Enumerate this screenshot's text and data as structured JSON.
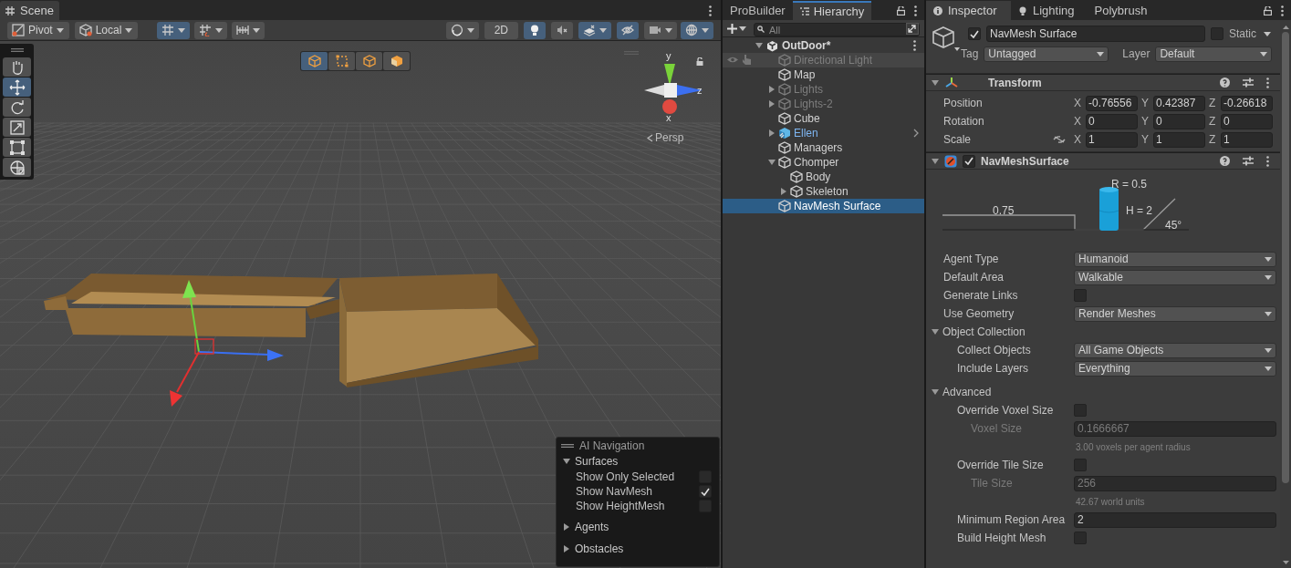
{
  "scene": {
    "tab": "Scene",
    "toolbar": [
      {
        "kind": "pivot",
        "label": "Pivot",
        "selected": false
      },
      {
        "kind": "local",
        "label": "Local",
        "selected": false
      },
      {
        "kind": "grid-snap",
        "selected": true
      },
      {
        "kind": "increment-snap",
        "selected": false
      },
      {
        "kind": "grid",
        "selected": false
      },
      {
        "kind": "shading",
        "selected": false
      },
      {
        "kind": "mode",
        "label": "2D",
        "selected": false
      },
      {
        "kind": "lighting",
        "selected": true
      },
      {
        "kind": "audio",
        "selected": false
      },
      {
        "kind": "effects",
        "selected": true
      },
      {
        "kind": "visibility",
        "selected": true
      },
      {
        "kind": "camera",
        "selected": false
      },
      {
        "kind": "gizmos",
        "selected": true
      }
    ],
    "tools": [
      {
        "kind": "hand",
        "selected": false
      },
      {
        "kind": "move",
        "selected": true
      },
      {
        "kind": "rotate",
        "selected": false
      },
      {
        "kind": "scale",
        "selected": false
      },
      {
        "kind": "rect",
        "selected": false
      },
      {
        "kind": "transform",
        "selected": false
      }
    ],
    "view_buttons": [
      {
        "kind": "cube",
        "selected": true
      },
      {
        "kind": "rect",
        "selected": false
      },
      {
        "kind": "cube",
        "selected": false
      },
      {
        "kind": "solid-cube",
        "selected": false
      }
    ],
    "orientation": {
      "y": "y",
      "z": "z",
      "x": "x",
      "projection": "Persp"
    },
    "ai_navigation": {
      "title": "AI Navigation",
      "sections": [
        {
          "label": "Surfaces",
          "expanded": true,
          "options": [
            {
              "label": "Show Only Selected",
              "checked": false
            },
            {
              "label": "Show NavMesh",
              "checked": true
            },
            {
              "label": "Show HeightMesh",
              "checked": false
            }
          ]
        },
        {
          "label": "Agents",
          "expanded": false
        },
        {
          "label": "Obstacles",
          "expanded": false
        }
      ]
    }
  },
  "hierarchy": {
    "tabs": [
      {
        "label": "ProBuilder",
        "selected": false
      },
      {
        "label": "Hierarchy",
        "selected": true
      }
    ],
    "search": {
      "placeholder": "All"
    },
    "scene_name": "OutDoor*",
    "items": [
      {
        "label": "Directional Light",
        "kind": "object",
        "disabled": true,
        "hovered": true,
        "selected": false
      },
      {
        "label": "Map",
        "kind": "object",
        "disabled": false,
        "hovered": false,
        "selected": false
      },
      {
        "label": "Lights",
        "kind": "object",
        "disabled": true,
        "hovered": false,
        "selected": false,
        "expanded": false
      },
      {
        "label": "Lights-2",
        "kind": "object",
        "disabled": true,
        "hovered": false,
        "selected": false,
        "expanded": false
      },
      {
        "label": "Cube",
        "kind": "object",
        "disabled": false,
        "hovered": false,
        "selected": false
      },
      {
        "label": "Ellen",
        "kind": "prefab",
        "disabled": false,
        "hovered": false,
        "selected": false,
        "expanded": false
      },
      {
        "label": "Managers",
        "kind": "object",
        "disabled": false,
        "hovered": false,
        "selected": false
      },
      {
        "label": "Chomper",
        "kind": "object",
        "disabled": false,
        "hovered": false,
        "selected": false,
        "expanded": true,
        "children": [
          {
            "label": "Body",
            "kind": "object",
            "disabled": false,
            "hovered": false,
            "selected": false
          },
          {
            "label": "Skeleton",
            "kind": "object",
            "disabled": false,
            "hovered": false,
            "selected": false,
            "expanded": false
          }
        ]
      },
      {
        "label": "NavMesh Surface",
        "kind": "object",
        "disabled": false,
        "hovered": false,
        "selected": true
      }
    ]
  },
  "inspector": {
    "tabs": [
      {
        "label": "Inspector",
        "selected": true
      },
      {
        "label": "Lighting",
        "selected": false
      },
      {
        "label": "Polybrush",
        "selected": false
      }
    ],
    "object": {
      "active": true,
      "name": "NavMesh Surface",
      "static": false,
      "static_label": "Static",
      "tag_label": "Tag",
      "tag": "Untagged",
      "layer_label": "Layer",
      "layer": "Default"
    },
    "transform": {
      "title": "Transform",
      "expanded": true,
      "rows": [
        {
          "label": "Position",
          "link": false,
          "values": [
            {
              "axis": "X",
              "value": "-0.76556"
            },
            {
              "axis": "Y",
              "value": "0.42387"
            },
            {
              "axis": "Z",
              "value": "-0.26618"
            }
          ]
        },
        {
          "label": "Rotation",
          "link": false,
          "values": [
            {
              "axis": "X",
              "value": "0"
            },
            {
              "axis": "Y",
              "value": "0"
            },
            {
              "axis": "Z",
              "value": "0"
            }
          ]
        },
        {
          "label": "Scale",
          "link": true,
          "values": [
            {
              "axis": "X",
              "value": "1"
            },
            {
              "axis": "Y",
              "value": "1"
            },
            {
              "axis": "Z",
              "value": "1"
            }
          ]
        }
      ]
    },
    "navmesh": {
      "title": "NavMeshSurface",
      "enabled": true,
      "expanded": true,
      "diagram": {
        "radius": "R = 0.5",
        "step": "0.75",
        "height": "H = 2",
        "slope": "45°"
      },
      "fields": [
        {
          "kind": "dropdown",
          "label": "Agent Type",
          "value": "Humanoid"
        },
        {
          "kind": "dropdown",
          "label": "Default Area",
          "value": "Walkable"
        },
        {
          "kind": "checkbox",
          "label": "Generate Links",
          "checked": false
        },
        {
          "kind": "dropdown",
          "label": "Use Geometry",
          "value": "Render Meshes"
        },
        {
          "kind": "section",
          "label": "Object Collection",
          "expanded": true,
          "children": [
            {
              "kind": "dropdown",
              "label": "Collect Objects",
              "value": "All Game Objects"
            },
            {
              "kind": "dropdown",
              "label": "Include Layers",
              "value": "Everything"
            }
          ]
        },
        {
          "kind": "section",
          "label": "Advanced",
          "expanded": true,
          "children": [
            {
              "kind": "checkbox",
              "label": "Override Voxel Size",
              "checked": false,
              "children": [
                {
                  "kind": "number",
                  "label": "Voxel Size",
                  "value": "0.1666667",
                  "disabled": true
                },
                {
                  "kind": "hint",
                  "label": "3.00 voxels per agent radius"
                }
              ]
            },
            {
              "kind": "checkbox",
              "label": "Override Tile Size",
              "checked": false,
              "children": [
                {
                  "kind": "number",
                  "label": "Tile Size",
                  "value": "256",
                  "disabled": true
                },
                {
                  "kind": "hint",
                  "label": "42.67 world units"
                }
              ]
            },
            {
              "kind": "number",
              "label": "Minimum Region Area",
              "value": "2",
              "disabled": false
            },
            {
              "kind": "checkbox",
              "label": "Build Height Mesh",
              "checked": false
            }
          ]
        }
      ]
    }
  }
}
